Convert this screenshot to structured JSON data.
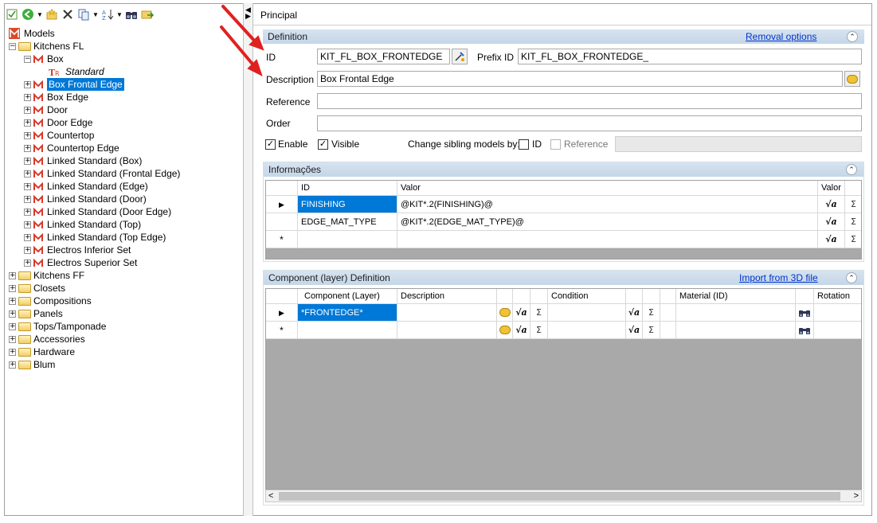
{
  "toolbar": {
    "icons": [
      "properties-icon",
      "back-icon",
      "dropdown-arrow",
      "new-folder-icon",
      "delete-icon",
      "copy-icon",
      "dropdown-arrow",
      "sort-icon",
      "dropdown-arrow",
      "find-icon",
      "export-icon"
    ]
  },
  "tree": {
    "root": "Models",
    "nodes": [
      {
        "label": "Kitchens FL",
        "type": "folder",
        "expander": "−"
      },
      {
        "label": "Box",
        "type": "model",
        "expander": "−"
      },
      {
        "label": "Standard",
        "type": "standard"
      },
      {
        "label": "Box Frontal Edge",
        "type": "model",
        "expander": "+",
        "selected": true
      },
      {
        "label": "Box Edge",
        "type": "model",
        "expander": "+"
      },
      {
        "label": "Door",
        "type": "model",
        "expander": "+"
      },
      {
        "label": "Door Edge",
        "type": "model",
        "expander": "+"
      },
      {
        "label": "Countertop",
        "type": "model",
        "expander": "+"
      },
      {
        "label": "Countertop Edge",
        "type": "model",
        "expander": "+"
      },
      {
        "label": "Linked Standard (Box)",
        "type": "model",
        "expander": "+"
      },
      {
        "label": "Linked Standard (Frontal Edge)",
        "type": "model",
        "expander": "+"
      },
      {
        "label": "Linked Standard (Edge)",
        "type": "model",
        "expander": "+"
      },
      {
        "label": "Linked Standard (Door)",
        "type": "model",
        "expander": "+"
      },
      {
        "label": "Linked Standard (Door Edge)",
        "type": "model",
        "expander": "+"
      },
      {
        "label": "Linked Standard (Top)",
        "type": "model",
        "expander": "+"
      },
      {
        "label": "Linked Standard (Top Edge)",
        "type": "model",
        "expander": "+"
      },
      {
        "label": "Electros Inferior Set",
        "type": "model",
        "expander": "+"
      },
      {
        "label": "Electros Superior Set",
        "type": "model",
        "expander": "+"
      },
      {
        "label": "Kitchens FF",
        "type": "folder",
        "expander": "+"
      },
      {
        "label": "Closets",
        "type": "folder",
        "expander": "+"
      },
      {
        "label": "Compositions",
        "type": "folder",
        "expander": "+"
      },
      {
        "label": "Panels",
        "type": "folder",
        "expander": "+"
      },
      {
        "label": "Tops/Tamponade",
        "type": "folder",
        "expander": "+"
      },
      {
        "label": "Accessories",
        "type": "folder",
        "expander": "+"
      },
      {
        "label": "Hardware",
        "type": "folder",
        "expander": "+"
      },
      {
        "label": "Blum",
        "type": "folder",
        "expander": "+"
      }
    ]
  },
  "header": {
    "title": "Principal"
  },
  "definition": {
    "title": "Definition",
    "removal_link": "Removal options",
    "id_label": "ID",
    "id_value": "KIT_FL_BOX_FRONTEDGE",
    "prefix_label": "Prefix ID",
    "prefix_value": "KIT_FL_BOX_FRONTEDGE_",
    "description_label": "Description",
    "description_value": "Box Frontal Edge",
    "reference_label": "Reference",
    "reference_value": "",
    "order_label": "Order",
    "order_value": "",
    "enable_label": "Enable",
    "visible_label": "Visible",
    "sibling_label": "Change sibling models by:",
    "sibling_id_label": "ID",
    "sibling_ref_label": "Reference"
  },
  "informacoes": {
    "title": "Informações",
    "columns": [
      "ID",
      "Valor",
      "Valor"
    ],
    "rows": [
      {
        "id": "FINISHING",
        "valor": "@KIT*.2(FINISHING)@"
      },
      {
        "id": "EDGE_MAT_TYPE",
        "valor": "@KIT*.2(EDGE_MAT_TYPE)@"
      }
    ]
  },
  "components": {
    "title": "Component (layer) Definition",
    "import_link": "Import from 3D file",
    "columns": [
      "Component (Layer)",
      "Description",
      "Condition",
      "Material (ID)",
      "Rotation"
    ],
    "rows": [
      {
        "component": "*FRONTEDGE*"
      }
    ]
  },
  "glyphs": {
    "sqrt": "√a",
    "sigma": "Σ",
    "row_current": "▶",
    "row_new": "*",
    "scroll_left": "<",
    "scroll_right": ">",
    "collapse": "⌃"
  },
  "colors": {
    "selection": "#0078d7",
    "panel_header": "#c4d6e8",
    "link": "#0033cc",
    "annotation": "#e02020"
  }
}
